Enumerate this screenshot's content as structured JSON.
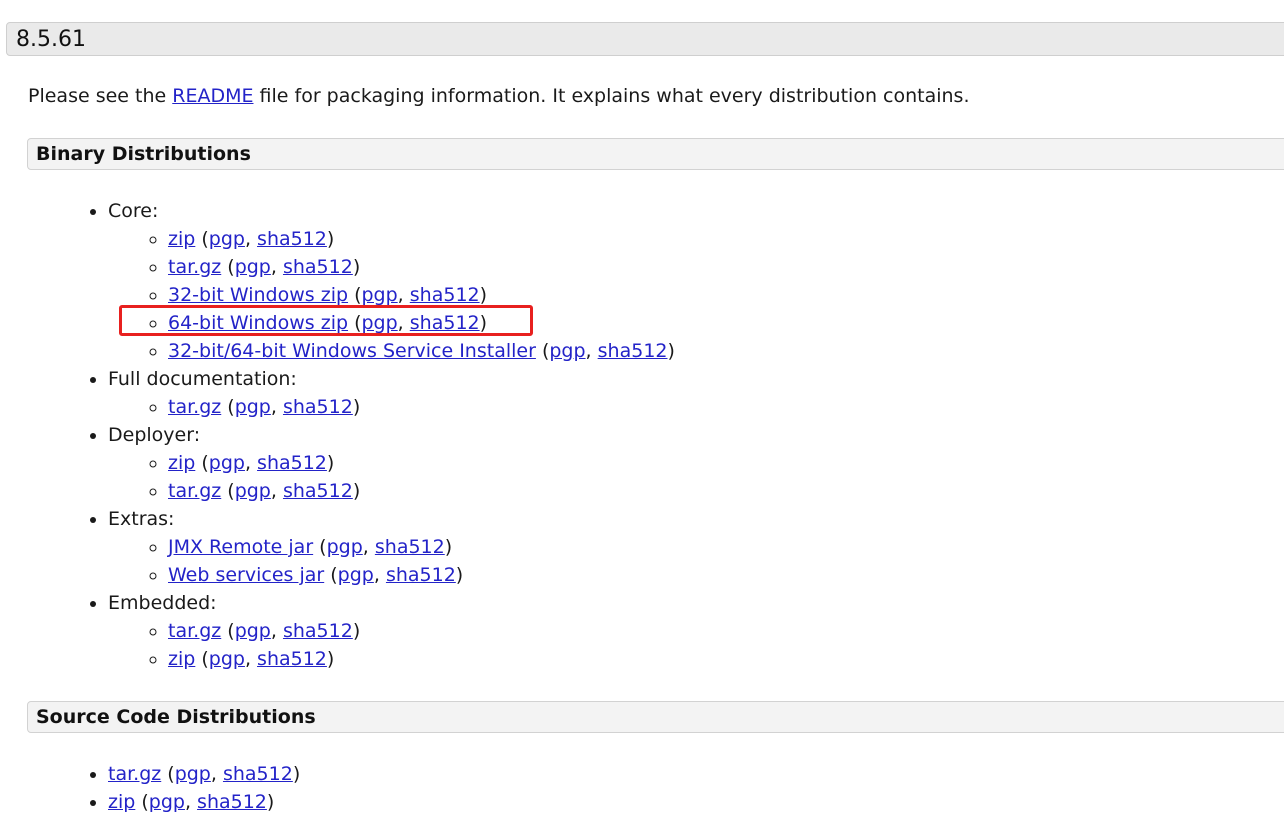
{
  "version": {
    "title": "8.5.61"
  },
  "intro": {
    "before": "Please see the ",
    "readme_link": "README",
    "after": " file for packaging information. It explains what every distribution contains."
  },
  "binary": {
    "title": "Binary Distributions",
    "core": {
      "label": "Core:",
      "items": [
        {
          "name": "zip",
          "pgp": "pgp",
          "sha": "sha512"
        },
        {
          "name": "tar.gz",
          "pgp": "pgp",
          "sha": "sha512"
        },
        {
          "name": "32-bit Windows zip",
          "pgp": "pgp",
          "sha": "sha512"
        },
        {
          "name": "64-bit Windows zip",
          "pgp": "pgp",
          "sha": "sha512"
        },
        {
          "name": "32-bit/64-bit Windows Service Installer",
          "pgp": "pgp",
          "sha": "sha512"
        }
      ]
    },
    "docs": {
      "label": "Full documentation:",
      "items": [
        {
          "name": "tar.gz",
          "pgp": "pgp",
          "sha": "sha512"
        }
      ]
    },
    "deployer": {
      "label": "Deployer:",
      "items": [
        {
          "name": "zip",
          "pgp": "pgp",
          "sha": "sha512"
        },
        {
          "name": "tar.gz",
          "pgp": "pgp",
          "sha": "sha512"
        }
      ]
    },
    "extras": {
      "label": "Extras:",
      "items": [
        {
          "name": "JMX Remote jar",
          "pgp": "pgp",
          "sha": "sha512"
        },
        {
          "name": "Web services jar",
          "pgp": "pgp",
          "sha": "sha512"
        }
      ]
    },
    "embedded": {
      "label": "Embedded:",
      "items": [
        {
          "name": "tar.gz",
          "pgp": "pgp",
          "sha": "sha512"
        },
        {
          "name": "zip",
          "pgp": "pgp",
          "sha": "sha512"
        }
      ]
    }
  },
  "source": {
    "title": "Source Code Distributions",
    "items": [
      {
        "name": "tar.gz",
        "pgp": "pgp",
        "sha": "sha512"
      },
      {
        "name": "zip",
        "pgp": "pgp",
        "sha": "sha512"
      }
    ]
  },
  "punct": {
    "open": " (",
    "comma": ", ",
    "close": ")"
  },
  "colors": {
    "link": "#2323c8",
    "highlight": "#e8201f"
  }
}
